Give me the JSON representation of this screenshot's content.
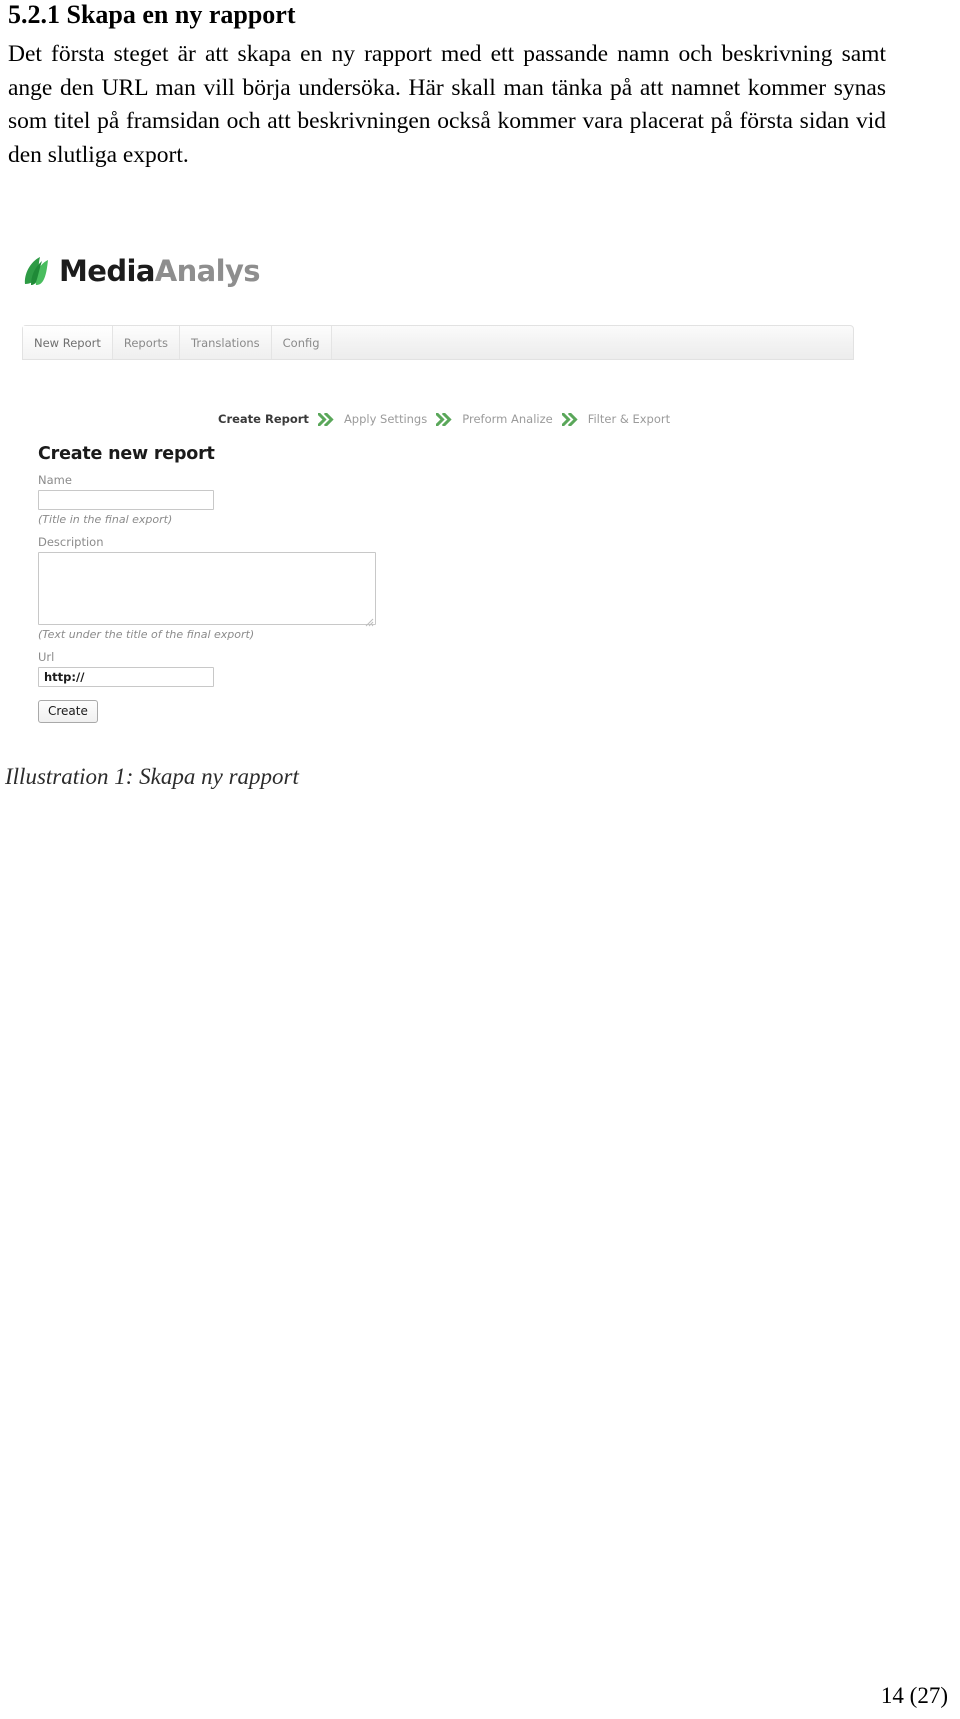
{
  "document": {
    "heading": "5.2.1 Skapa en ny rapport",
    "paragraph": "Det första steget är att skapa en ny rapport med ett passande namn och beskrivning samt ange den URL man vill börja undersöka. Här skall man tänka på att namnet kommer synas som titel på framsidan och att beskrivningen också kommer vara placerat på första sidan vid den slutliga export.",
    "caption": "Illustration 1: Skapa ny rapport",
    "page_number": "14 (27)"
  },
  "app": {
    "logo": {
      "icon": "leaf-icon",
      "text_primary": "Media",
      "text_secondary": "Analys",
      "leaf_color": "#33aa4d",
      "primary_color": "#1c1c1c",
      "secondary_color": "#8e8e8e"
    },
    "tabs": [
      {
        "label": "New Report",
        "active": true
      },
      {
        "label": "Reports",
        "active": false
      },
      {
        "label": "Translations",
        "active": false
      },
      {
        "label": "Config",
        "active": false
      }
    ],
    "steps": [
      {
        "label": "Create Report",
        "current": true
      },
      {
        "label": "Apply Settings",
        "current": false
      },
      {
        "label": "Preform Analize",
        "current": false
      },
      {
        "label": "Filter & Export",
        "current": false
      }
    ],
    "step_separator_color": "#5aa75a",
    "form": {
      "title": "Create new report",
      "name_label": "Name",
      "name_value": "",
      "name_hint": "(Title in the final export)",
      "description_label": "Description",
      "description_value": "",
      "description_hint": "(Text under the title of the final export)",
      "url_label": "Url",
      "url_value": "http://",
      "submit_label": "Create"
    }
  }
}
